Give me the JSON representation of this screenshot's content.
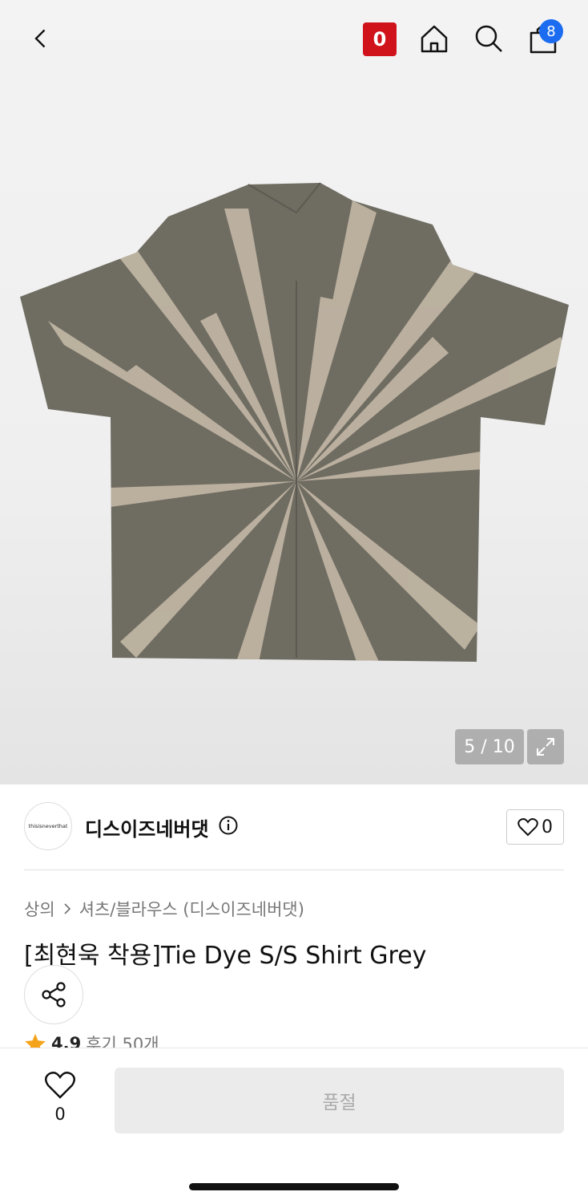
{
  "header": {
    "back_icon": "chevron-left-icon",
    "badge_label": "0",
    "home_icon": "home-icon",
    "search_icon": "search-icon",
    "bag_icon": "shopping-bag-icon",
    "bag_count": "8",
    "badge_color": "#d0121b",
    "bag_count_color": "#1b6cf0"
  },
  "gallery": {
    "counter": "5 / 10",
    "expand_icon": "expand-icon"
  },
  "brand": {
    "logo_text": "thisisneverthat",
    "name": "디스이즈네버댓",
    "info_icon": "info-icon",
    "like_icon": "heart-icon",
    "like_count": "0"
  },
  "breadcrumb": {
    "level1": "상의",
    "separator_icon": "chevron-right-icon",
    "level2": "셔츠/블라우스 (디스이즈네버댓)"
  },
  "product": {
    "title": "[최현욱 착용]Tie Dye S/S Shirt Grey",
    "share_icon": "share-icon",
    "star_icon": "star-icon",
    "rating": "4.9",
    "reviews": "후기 50개"
  },
  "bottom": {
    "wish_icon": "heart-icon",
    "wish_count": "0",
    "soldout_label": "품절"
  }
}
